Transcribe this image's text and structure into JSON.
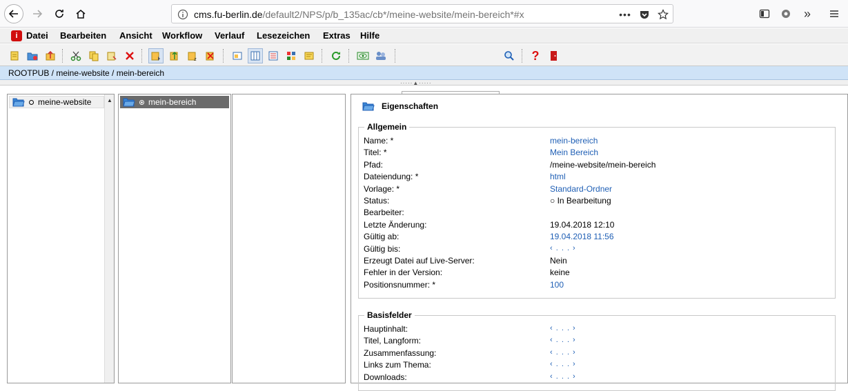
{
  "browser": {
    "url_host": "cms.fu-berlin.de",
    "url_path": "/default2/NPS/p/b_135ac/cb*/meine-website/mein-bereich*#x"
  },
  "menu": {
    "items": [
      "Datei",
      "Bearbeiten",
      "Ansicht",
      "Workflow",
      "Verlauf",
      "Lesezeichen",
      "Extras",
      "Hilfe"
    ]
  },
  "search": {
    "value": ""
  },
  "breadcrumb": "ROOTPUB / meine-website / mein-bereich",
  "columns": {
    "col1_item": "meine-website",
    "col2_item": "mein-bereich"
  },
  "panel": {
    "title": "Eigenschaften",
    "allgemein": {
      "legend": "Allgemein",
      "rows": [
        {
          "label": "Name: *",
          "value": "mein-bereich",
          "link": true
        },
        {
          "label": "Titel: *",
          "value": "Mein Bereich",
          "link": true
        },
        {
          "label": "Pfad:",
          "value": "/meine-website/mein-bereich",
          "link": false
        },
        {
          "label": "Dateiendung: *",
          "value": "html",
          "link": true
        },
        {
          "label": "Vorlage: *",
          "value": "Standard-Ordner",
          "link": true
        },
        {
          "label": "Status:",
          "value": "○ In Bearbeitung",
          "link": false
        },
        {
          "label": "Bearbeiter:",
          "value": "",
          "link": false
        },
        {
          "label": "Letzte Änderung:",
          "value": "19.04.2018 12:10",
          "link": false
        },
        {
          "label": "Gültig ab:",
          "value": "19.04.2018 11:56",
          "link": true
        },
        {
          "label": "Gültig bis:",
          "value": "‹ . . . ›",
          "link": true
        },
        {
          "label": "Erzeugt Datei auf Live-Server:",
          "value": "Nein",
          "link": false
        },
        {
          "label": "Fehler in der Version:",
          "value": "keine",
          "link": false
        },
        {
          "label": "Positionsnummer: *",
          "value": "100",
          "link": true
        }
      ]
    },
    "basisfelder": {
      "legend": "Basisfelder",
      "rows": [
        {
          "label": "Hauptinhalt:",
          "value": "‹ . . . ›"
        },
        {
          "label": "Titel, Langform:",
          "value": "‹ . . . ›"
        },
        {
          "label": "Zusammenfassung:",
          "value": "‹ . . . ›"
        },
        {
          "label": "Links zum Thema:",
          "value": "‹ . . . ›"
        },
        {
          "label": "Downloads:",
          "value": "‹ . . . ›"
        }
      ]
    }
  },
  "colors": {
    "link": "#1f5fb5",
    "breadcrumb_bg": "#cfe3f7",
    "selected_bg": "#6b6b6b"
  }
}
